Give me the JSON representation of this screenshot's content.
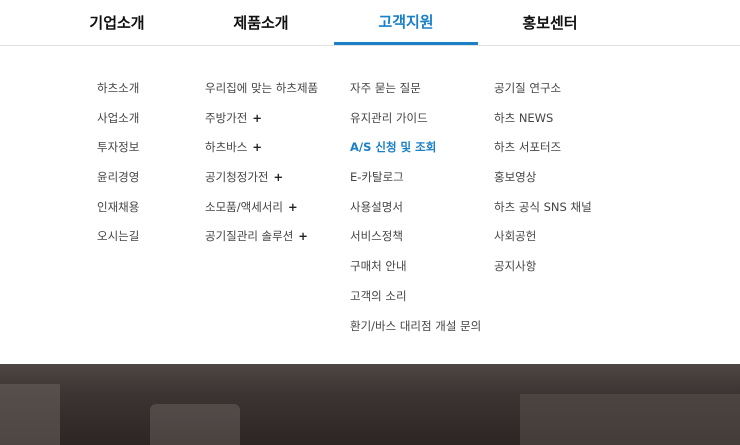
{
  "top_nav": {
    "tabs": [
      {
        "label": "기업소개"
      },
      {
        "label": "제품소개"
      },
      {
        "label": "고객지원",
        "active": true
      },
      {
        "label": "홍보센터"
      }
    ]
  },
  "mega_menu": {
    "columns": [
      {
        "items": [
          {
            "label": "하츠소개"
          },
          {
            "label": "사업소개"
          },
          {
            "label": "투자정보"
          },
          {
            "label": "윤리경영"
          },
          {
            "label": "인재채용"
          },
          {
            "label": "오시는길"
          }
        ]
      },
      {
        "items": [
          {
            "label": "우리집에 맞는 하츠제품"
          },
          {
            "label": "주방가전",
            "expand": "+"
          },
          {
            "label": "하츠바스",
            "expand": "+"
          },
          {
            "label": "공기청정가전",
            "expand": "+"
          },
          {
            "label": "소모품/액세서리",
            "expand": "+"
          },
          {
            "label": "공기질관리 솔루션",
            "expand": "+"
          }
        ]
      },
      {
        "items": [
          {
            "label": "자주 묻는 질문"
          },
          {
            "label": "유지관리 가이드"
          },
          {
            "label": "A/S 신청 및 조회",
            "active": true
          },
          {
            "label": "E-카탈로그"
          },
          {
            "label": "사용설명서"
          },
          {
            "label": "서비스정책"
          },
          {
            "label": "구매처 안내"
          },
          {
            "label": "고객의 소리"
          },
          {
            "label": "환기/바스 대리점 개설 문의"
          }
        ]
      },
      {
        "items": [
          {
            "label": "공기질 연구소"
          },
          {
            "label": "하츠 NEWS"
          },
          {
            "label": "하츠 서포터즈"
          },
          {
            "label": "홍보영상"
          },
          {
            "label": "하츠 공식 SNS 채널"
          },
          {
            "label": "사회공헌"
          },
          {
            "label": "공지사항"
          }
        ]
      }
    ]
  },
  "colors": {
    "accent": "#1a80c8"
  }
}
